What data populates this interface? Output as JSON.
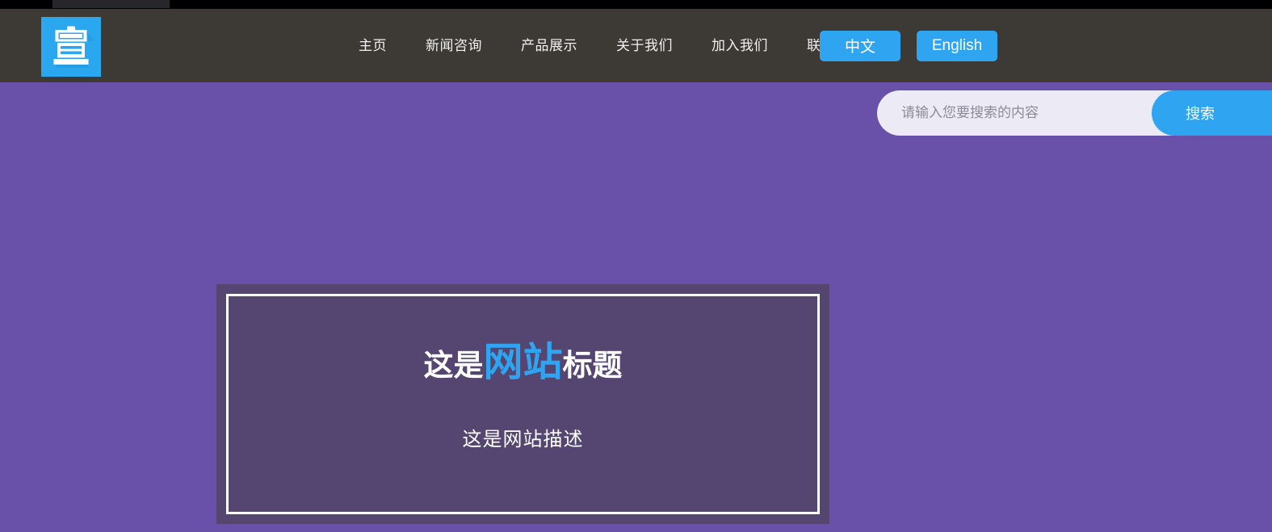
{
  "browser": {
    "tab_strip_color": "#000000",
    "active_tab_color": "#27272a"
  },
  "header": {
    "background_color": "#3d3935",
    "logo": {
      "icon": "clipboard-icon",
      "background_color": "#2aa7ef",
      "glyph_color": "#ffffff"
    },
    "nav": [
      {
        "label": "主页"
      },
      {
        "label": "新闻咨询"
      },
      {
        "label": "产品展示"
      },
      {
        "label": "关于我们"
      },
      {
        "label": "加入我们"
      },
      {
        "label": "联系我们"
      }
    ],
    "language_buttons": [
      {
        "label": "中文",
        "active": true
      },
      {
        "label": "English",
        "active": false
      }
    ],
    "accent_color": "#2fa5f2"
  },
  "hero": {
    "background_color": "#6950a8",
    "card_background_color": "#544670",
    "card_border_color": "#ffffff",
    "title": {
      "prefix": "这是",
      "accent": "网站",
      "suffix": "标题",
      "accent_color": "#2fa5f2",
      "text_color": "#ffffff"
    },
    "description": "这是网站描述"
  },
  "search": {
    "placeholder": "请输入您要搜索的内容",
    "value": "",
    "button_label": "搜索",
    "field_background_color": "#ecebf5",
    "button_color": "#2fa5f2"
  }
}
